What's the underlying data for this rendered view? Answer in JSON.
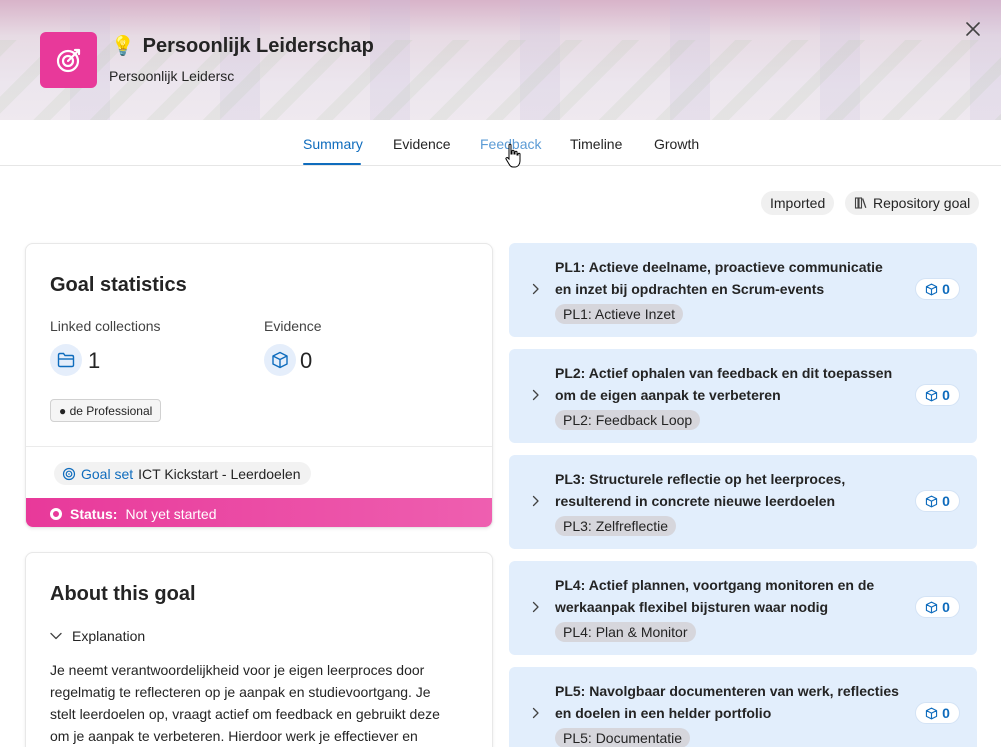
{
  "header": {
    "title": "Persoonlijk Leiderschap",
    "subtitle": "Persoonlijk Leidersc",
    "title_emoji": "💡",
    "avatar_color": "#e8399a"
  },
  "tabs": [
    {
      "label": "Summary",
      "active": true
    },
    {
      "label": "Evidence"
    },
    {
      "label": "Feedback",
      "hovered": true
    },
    {
      "label": "Timeline"
    },
    {
      "label": "Growth"
    }
  ],
  "tags": {
    "imported": "Imported",
    "repository": "Repository goal"
  },
  "stats": {
    "title": "Goal statistics",
    "linked_label": "Linked collections",
    "linked_value": "1",
    "evidence_label": "Evidence",
    "evidence_value": "0",
    "badge": "● de Professional",
    "goalset_link": "Goal set",
    "goalset_name": "ICT Kickstart - Leerdoelen",
    "status_label": "Status:",
    "status_value": "Not yet started",
    "status_color": "#e8399a"
  },
  "about": {
    "title": "About this goal",
    "explanation_label": "Explanation",
    "text": "Je neemt verantwoordelijkheid voor je eigen leerproces door regelmatig te reflecteren op je aanpak en studievoortgang. Je stelt leerdoelen op, vraagt actief om feedback en gebruikt deze om je aanpak te verbeteren. Hierdoor werk je effectiever en"
  },
  "pl_items": [
    {
      "title": "PL1: Actieve deelname, proactieve communicatie en inzet bij opdrachten en Scrum-events",
      "tag": "PL1: Actieve Inzet",
      "count": "0"
    },
    {
      "title": "PL2: Actief ophalen van feedback en dit toepassen om de eigen aanpak te verbeteren",
      "tag": "PL2: Feedback Loop",
      "count": "0"
    },
    {
      "title": "PL3: Structurele reflectie op het leerproces, resulterend in concrete nieuwe leerdoelen",
      "tag": "PL3: Zelfreflectie",
      "count": "0"
    },
    {
      "title": "PL4: Actief plannen, voortgang monitoren en de werkaanpak flexibel bijsturen waar nodig",
      "tag": "PL4: Plan & Monitor",
      "count": "0"
    },
    {
      "title": "PL5: Navolgbaar documenteren van werk, reflecties en doelen in een helder portfolio",
      "tag": "PL5: Documentatie",
      "count": "0"
    }
  ],
  "colors": {
    "accent": "#0f6cbd",
    "card_bg": "#e2eefc"
  }
}
